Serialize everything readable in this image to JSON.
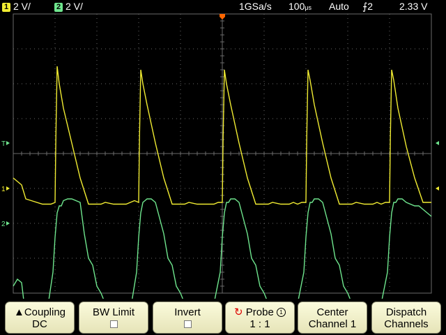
{
  "status": {
    "ch1_badge": "1",
    "ch1_scale": "2 V/",
    "ch2_badge": "2",
    "ch2_scale": "2 V/",
    "sample_rate": "1GSa/s",
    "timebase": "100",
    "timebase_unit": "μs",
    "trigger_mode": "Auto",
    "trigger_source": "2",
    "trigger_level": "2.33 V"
  },
  "colors": {
    "ch1": "#f1ec32",
    "ch2": "#6fe68e",
    "grid": "#6a6a6a",
    "trigger": "#ff6600"
  },
  "markers": {
    "ch1_ground": "1",
    "ch2_ground": "2",
    "trigger_level": "T"
  },
  "softkeys": [
    {
      "label": "Coupling",
      "value": "DC",
      "arrow": "▲"
    },
    {
      "label": "BW Limit",
      "value": ""
    },
    {
      "label": "Invert",
      "value": ""
    },
    {
      "label": "Probe",
      "value": "1 : 1",
      "knob": "1"
    },
    {
      "label": "Center",
      "value": "Channel 1"
    },
    {
      "label": "Dispatch",
      "value": "Channels"
    }
  ],
  "chart_data": {
    "type": "line",
    "x_unit": "μs",
    "xlim": [
      -500,
      500
    ],
    "ylim": [
      -4,
      4
    ],
    "y_unit": "div",
    "series": [
      {
        "name": "1",
        "x": [
          -500,
          -490,
          -480,
          -470,
          -430,
          -410,
          -400,
          -398,
          -395,
          -390,
          -380,
          -360,
          -340,
          -320,
          -310,
          -300,
          -290,
          -280,
          -260,
          -240,
          -230,
          -220,
          -210,
          -200,
          -198,
          -195,
          -190,
          -180,
          -160,
          -140,
          -120,
          -110,
          -100,
          -90,
          -80,
          -60,
          -40,
          -30,
          -20,
          -10,
          0,
          2,
          5,
          10,
          20,
          40,
          60,
          80,
          90,
          100,
          110,
          120,
          140,
          160,
          170,
          180,
          190,
          200,
          202,
          205,
          210,
          220,
          240,
          260,
          280,
          290,
          300,
          310,
          320,
          340,
          360,
          370,
          380,
          390,
          400,
          402,
          405,
          410,
          420,
          440,
          460,
          480,
          500
        ],
        "y": [
          0.3,
          0.2,
          0.1,
          -0.3,
          -0.45,
          -0.45,
          -0.4,
          1.5,
          3.5,
          3.0,
          2.3,
          1.3,
          0.3,
          -0.45,
          -0.45,
          -0.45,
          -0.45,
          -0.4,
          -0.45,
          -0.45,
          -0.45,
          -0.4,
          -0.35,
          -0.4,
          1.5,
          3.4,
          3.0,
          2.4,
          1.3,
          0.3,
          -0.45,
          -0.45,
          -0.45,
          -0.45,
          -0.4,
          -0.45,
          -0.45,
          -0.45,
          -0.45,
          -0.4,
          -0.4,
          1.5,
          3.4,
          3.0,
          2.4,
          1.3,
          0.3,
          -0.45,
          -0.45,
          -0.45,
          -0.45,
          -0.4,
          -0.45,
          -0.45,
          -0.4,
          -0.45,
          -0.4,
          -0.4,
          1.5,
          3.4,
          3.1,
          2.4,
          1.3,
          0.3,
          -0.45,
          -0.45,
          -0.45,
          -0.45,
          -0.4,
          -0.45,
          -0.45,
          -0.4,
          -0.45,
          -0.4,
          -0.4,
          1.5,
          3.4,
          3.1,
          2.3,
          1.2,
          0.3,
          -0.4,
          -0.4
        ]
      },
      {
        "name": "2",
        "x": [
          -500,
          -490,
          -480,
          -470,
          -440,
          -420,
          -405,
          -400,
          -395,
          -390,
          -385,
          -380,
          -370,
          -360,
          -340,
          -330,
          -320,
          -310,
          -300,
          -290,
          -280,
          -270,
          -260,
          -250,
          -240,
          -230,
          -220,
          -205,
          -200,
          -195,
          -190,
          -185,
          -180,
          -170,
          -160,
          -140,
          -130,
          -120,
          -110,
          -100,
          -90,
          -80,
          -70,
          -60,
          -50,
          -40,
          -30,
          -20,
          -5,
          0,
          5,
          10,
          15,
          20,
          30,
          40,
          60,
          70,
          80,
          90,
          100,
          110,
          120,
          130,
          140,
          150,
          160,
          170,
          180,
          195,
          200,
          205,
          210,
          215,
          220,
          230,
          240,
          260,
          270,
          280,
          290,
          300,
          310,
          320,
          330,
          340,
          350,
          360,
          370,
          380,
          395,
          400,
          405,
          410,
          415,
          420,
          430,
          440,
          460,
          470,
          480,
          490,
          500
        ],
        "y": [
          -1.8,
          -1.6,
          -1.7,
          -2.7,
          -2.8,
          -2.6,
          -1.4,
          -0.4,
          0.3,
          0.5,
          0.5,
          0.65,
          0.7,
          0.7,
          0.6,
          -0.3,
          -1.0,
          -1.2,
          -1.8,
          -2.0,
          -2.3,
          -2.6,
          -2.7,
          -2.8,
          -2.8,
          -2.6,
          -2.5,
          -1.4,
          -0.4,
          0.3,
          0.6,
          0.65,
          0.7,
          0.7,
          0.6,
          -0.3,
          -1.0,
          -1.2,
          -1.8,
          -2.0,
          -2.3,
          -2.6,
          -2.7,
          -2.8,
          -2.8,
          -2.6,
          -2.5,
          -2.3,
          -1.4,
          -0.4,
          0.3,
          0.6,
          0.6,
          0.7,
          0.7,
          0.6,
          -0.3,
          -1.0,
          -1.2,
          -1.8,
          -2.0,
          -2.3,
          -2.6,
          -2.7,
          -2.8,
          -2.8,
          -2.6,
          -2.5,
          -2.3,
          -1.4,
          -0.4,
          0.3,
          0.6,
          0.6,
          0.7,
          0.7,
          0.6,
          -0.3,
          -1.0,
          -1.2,
          -1.8,
          -2.0,
          -2.3,
          -2.6,
          -2.7,
          -2.8,
          -2.8,
          -2.6,
          -2.5,
          -2.3,
          -1.4,
          -0.4,
          0.3,
          0.6,
          0.6,
          0.7,
          0.7,
          0.6,
          0.5,
          0.5,
          0.4,
          0.3,
          0.2
        ]
      }
    ]
  }
}
